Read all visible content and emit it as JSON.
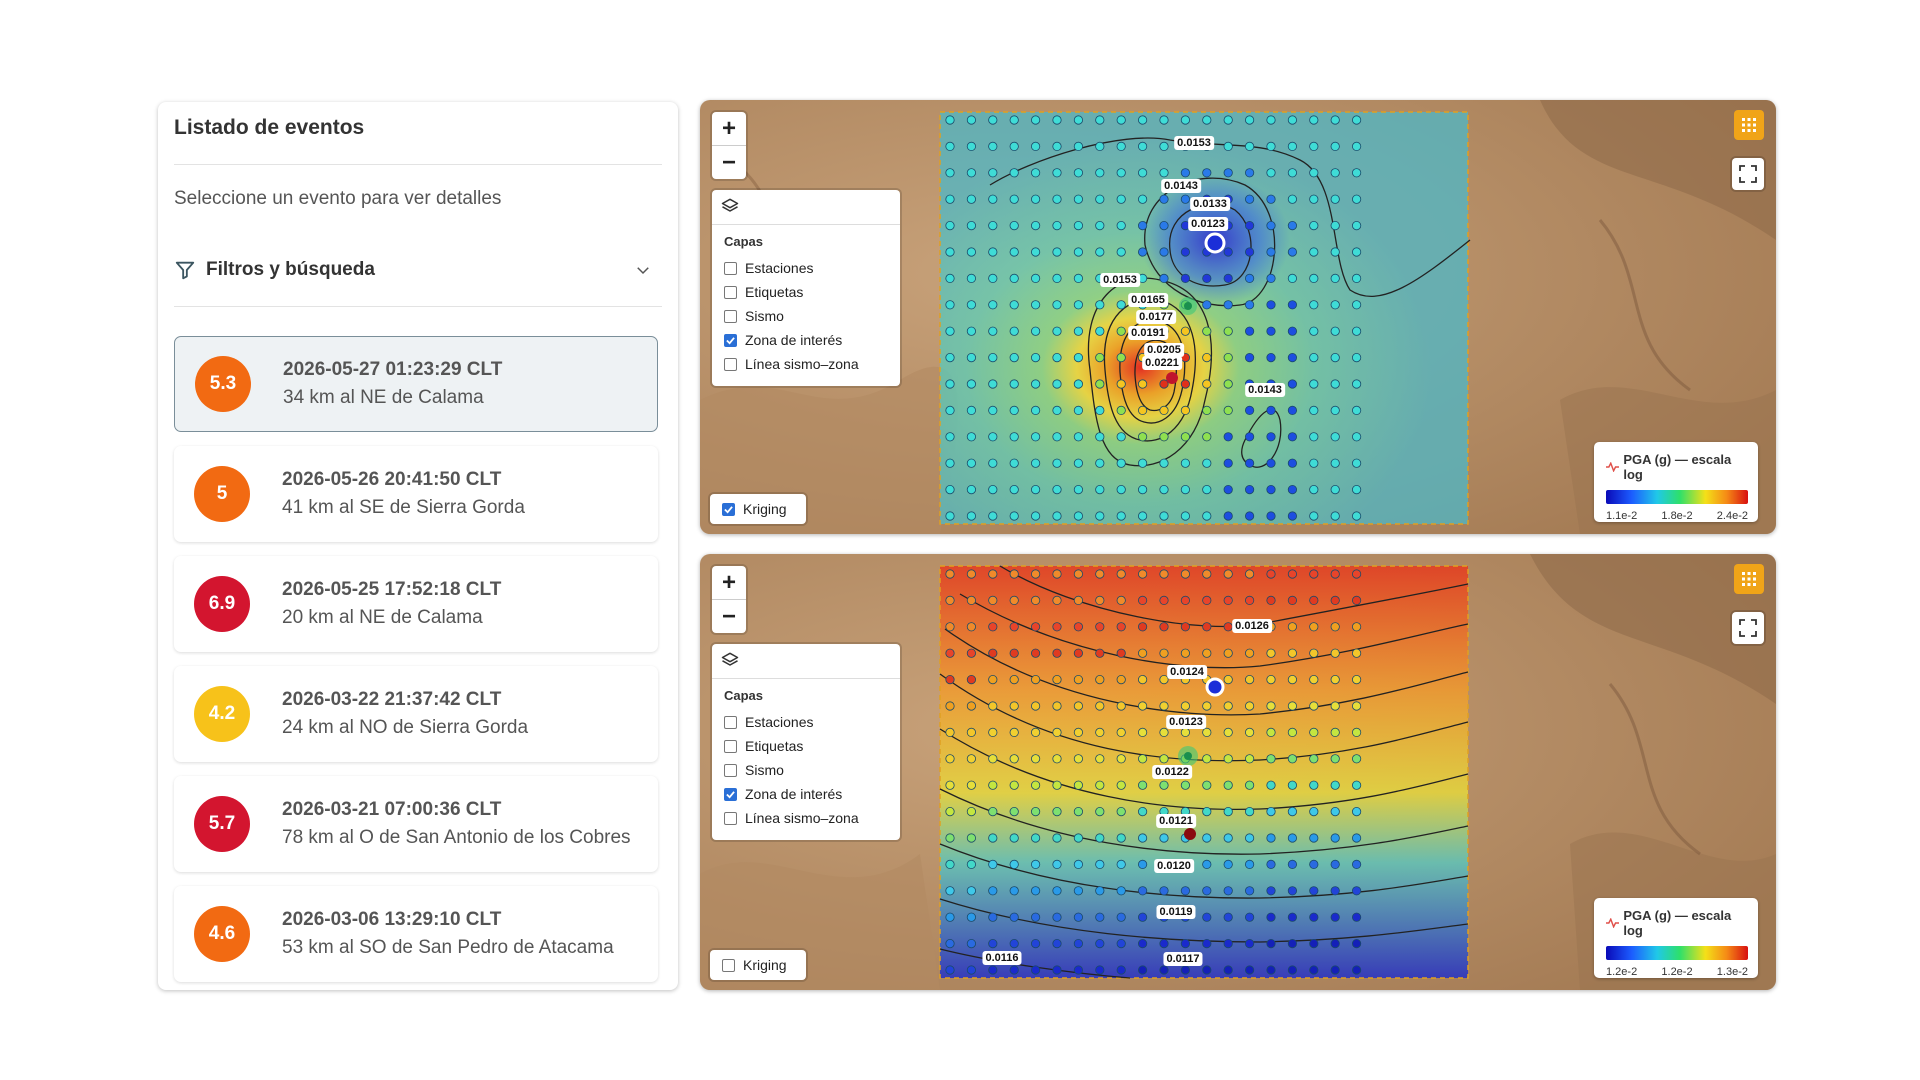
{
  "events_panel": {
    "title": "Listado de eventos",
    "subtitle": "Seleccione un evento para ver detalles",
    "filters_label": "Filtros y búsqueda",
    "events": [
      {
        "magnitude": "5.3",
        "date": "2026-05-27 01:23:29 CLT",
        "place": "34 km al NE de Calama",
        "color": "#f26a12",
        "selected": true
      },
      {
        "magnitude": "5",
        "date": "2026-05-26 20:41:50 CLT",
        "place": "41 km al SE de Sierra Gorda",
        "color": "#f26a12",
        "selected": false
      },
      {
        "magnitude": "6.9",
        "date": "2026-05-25 17:52:18 CLT",
        "place": "20 km al NE de Calama",
        "color": "#d3152f",
        "selected": false
      },
      {
        "magnitude": "4.2",
        "date": "2026-03-22 21:37:42 CLT",
        "place": "24 km al NO de Sierra Gorda",
        "color": "#f7c21a",
        "selected": false
      },
      {
        "magnitude": "5.7",
        "date": "2026-03-21 07:00:36 CLT",
        "place": "78 km al O de San Antonio de los Cobres",
        "color": "#d3152f",
        "selected": false
      },
      {
        "magnitude": "4.6",
        "date": "2026-03-06 13:29:10 CLT",
        "place": "53 km al SO de San Pedro de Atacama",
        "color": "#f26a12",
        "selected": false
      }
    ]
  },
  "maps": [
    {
      "zoom_in": "+",
      "zoom_out": "−",
      "layers_title": "Capas",
      "layers": [
        {
          "label": "Estaciones",
          "checked": false
        },
        {
          "label": "Etiquetas",
          "checked": false
        },
        {
          "label": "Sismo",
          "checked": false
        },
        {
          "label": "Zona de interés",
          "checked": true
        },
        {
          "label": "Línea sismo–zona",
          "checked": false
        }
      ],
      "kriging_label": "Kriging",
      "kriging_checked": true,
      "legend_title": "PGA (g) — escala log",
      "legend_ticks": [
        "1.1e-2",
        "1.8e-2",
        "2.4e-2"
      ],
      "contour_labels": [
        "0.0153",
        "0.0143",
        "0.0133",
        "0.0123",
        "0.0153",
        "0.0165",
        "0.0177",
        "0.0191",
        "0.0205",
        "0.0221",
        "0.0143"
      ]
    },
    {
      "zoom_in": "+",
      "zoom_out": "−",
      "layers_title": "Capas",
      "layers": [
        {
          "label": "Estaciones",
          "checked": false
        },
        {
          "label": "Etiquetas",
          "checked": false
        },
        {
          "label": "Sismo",
          "checked": false
        },
        {
          "label": "Zona de interés",
          "checked": true
        },
        {
          "label": "Línea sismo–zona",
          "checked": false
        }
      ],
      "kriging_label": "Kriging",
      "kriging_checked": false,
      "legend_title": "PGA (g) — escala log",
      "legend_ticks": [
        "1.2e-2",
        "1.2e-2",
        "1.3e-2"
      ],
      "contour_labels": [
        "0.0126",
        "0.0124",
        "0.0123",
        "0.0122",
        "0.0121",
        "0.0120",
        "0.0119",
        "0.0116",
        "0.0117"
      ]
    }
  ],
  "icons": {
    "filter": "filter-icon",
    "chevron": "chevron-down-icon",
    "layers": "layers-icon",
    "grid": "grid-icon",
    "fullscreen": "fullscreen-icon",
    "seismogram": "seismogram-icon"
  },
  "colors": {
    "accent_orange": "#f0a418",
    "checkbox_blue": "#2a6fd6"
  }
}
